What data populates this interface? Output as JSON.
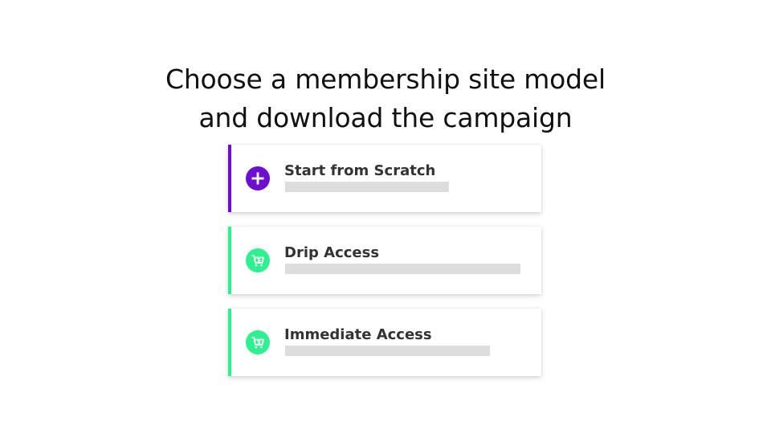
{
  "header": {
    "title_line1": "Choose a membership site model",
    "title_line2": "and download the campaign"
  },
  "options": [
    {
      "label": "Start from Scratch",
      "icon": "plus-circle-icon",
      "accent": "#6d0fd0"
    },
    {
      "label": "Drip Access",
      "icon": "cart-dollar-icon",
      "accent": "#2ef08e"
    },
    {
      "label": "Immediate Access",
      "icon": "cart-dollar-icon",
      "accent": "#2ef08e"
    }
  ]
}
